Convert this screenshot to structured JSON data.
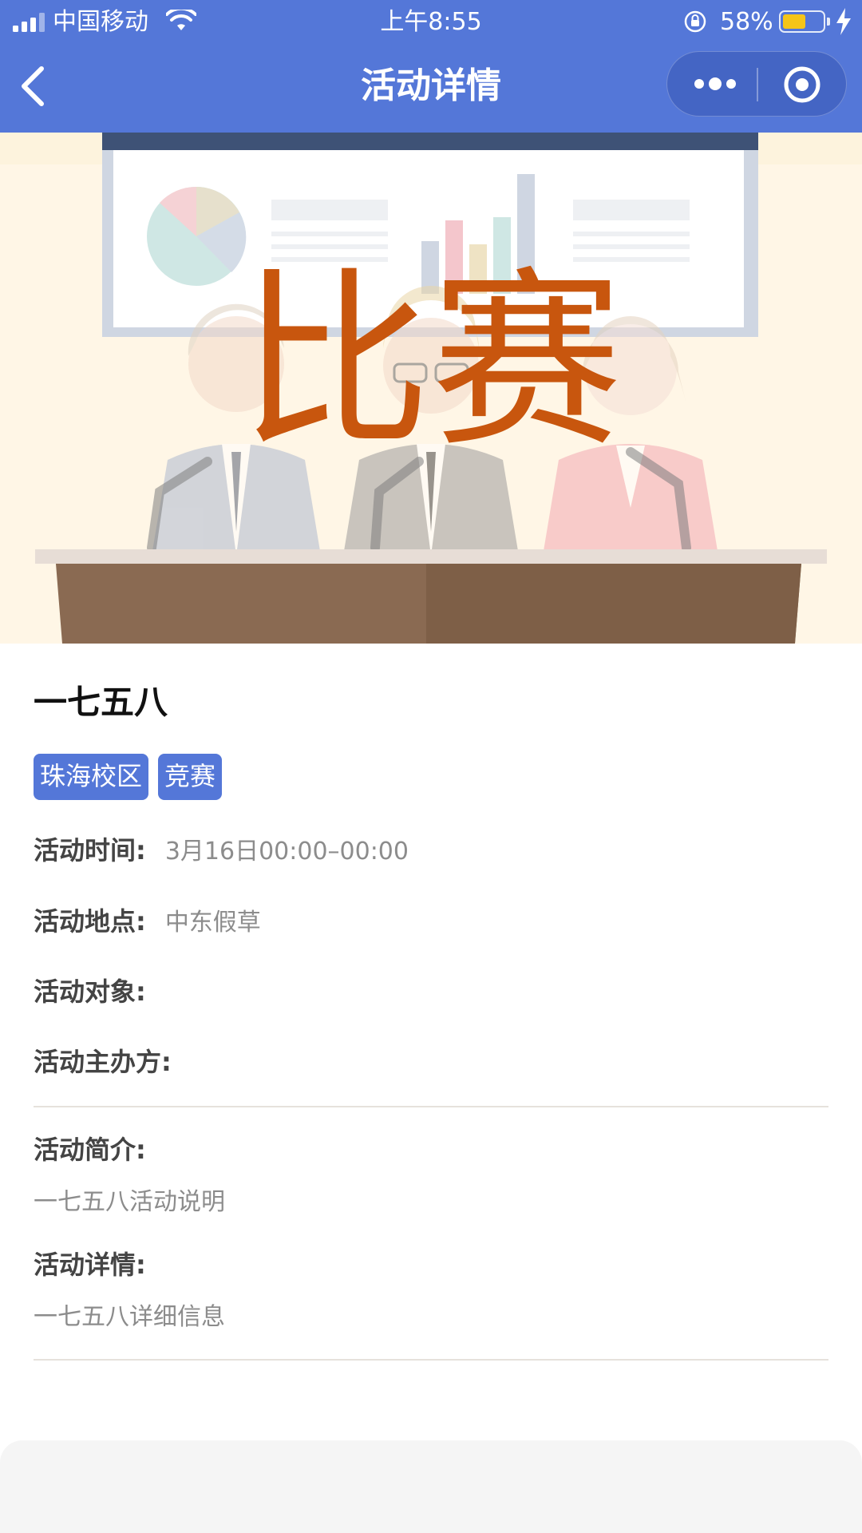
{
  "status_bar": {
    "carrier": "中国移动",
    "time": "上午8:55",
    "battery_percent": "58%",
    "battery_level": 0.58,
    "icons": [
      "signal-icon",
      "wifi-icon",
      "orientation-lock-icon",
      "battery-icon",
      "charging-icon"
    ]
  },
  "nav": {
    "title": "活动详情",
    "back_icon": "chevron-left-icon",
    "more_icon": "more-dots-icon",
    "close_icon": "target-circle-icon"
  },
  "banner": {
    "overlay_text": "比赛"
  },
  "activity": {
    "name": "一七五八",
    "tags": [
      "珠海校区",
      "竞赛"
    ],
    "time_label": "活动时间:",
    "time_value": "3月16日00:00–00:00",
    "location_label": "活动地点:",
    "location_value": "中东假草",
    "audience_label": "活动对象:",
    "audience_value": "",
    "organizer_label": "活动主办方:",
    "organizer_value": "",
    "intro_label": "活动简介:",
    "intro_text": "一七五八活动说明",
    "details_label": "活动详情:",
    "details_text": "一七五八详细信息"
  },
  "colors": {
    "accent": "#5477d8",
    "banner_text": "#c8560e",
    "muted_text": "#8c8c8c"
  }
}
